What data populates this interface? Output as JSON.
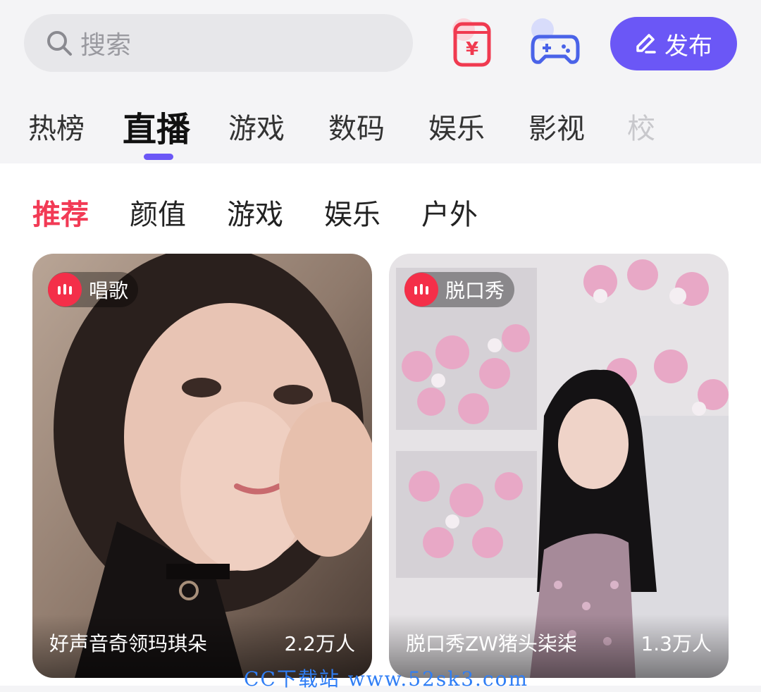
{
  "search": {
    "placeholder": "搜索"
  },
  "header": {
    "wallet_icon": "money-card-icon",
    "game_icon": "gamepad-icon",
    "publish_label": "发布"
  },
  "main_tabs": [
    {
      "label": "热榜",
      "active": false
    },
    {
      "label": "直播",
      "active": true
    },
    {
      "label": "游戏",
      "active": false
    },
    {
      "label": "数码",
      "active": false
    },
    {
      "label": "娱乐",
      "active": false
    },
    {
      "label": "影视",
      "active": false
    },
    {
      "label": "校",
      "active": false
    }
  ],
  "sub_tabs": [
    {
      "label": "推荐",
      "active": true
    },
    {
      "label": "颜值",
      "active": false
    },
    {
      "label": "游戏",
      "active": false
    },
    {
      "label": "娱乐",
      "active": false
    },
    {
      "label": "户外",
      "active": false
    }
  ],
  "cards": [
    {
      "category": "唱歌",
      "title": "好声音奇领玛琪朵",
      "viewers": "2.2万人"
    },
    {
      "category": "脱口秀",
      "title": "脱口秀ZW猪头柒柒",
      "viewers": "1.3万人"
    }
  ],
  "watermark": "CC下载站 www.52sk3.com",
  "colors": {
    "accent": "#6b57f6",
    "live_red": "#f42f49",
    "sub_active": "#f23a55"
  }
}
